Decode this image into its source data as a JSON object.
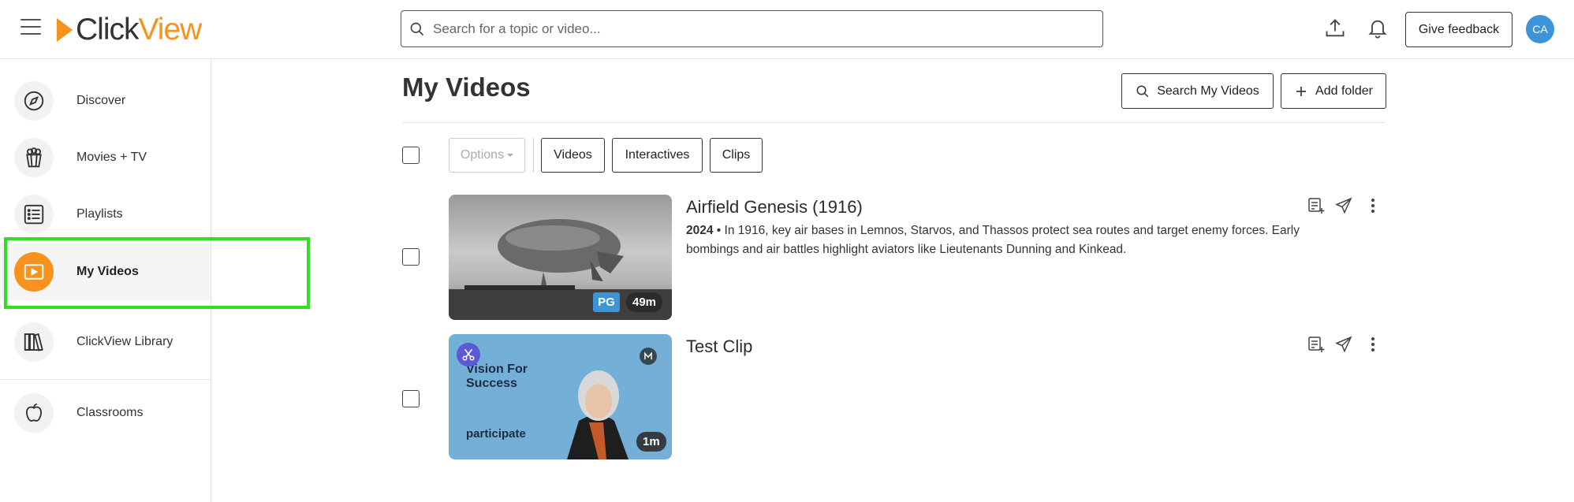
{
  "header": {
    "logo_part1": "Click",
    "logo_part2": "View",
    "search_placeholder": "Search for a topic or video...",
    "feedback_label": "Give feedback",
    "avatar_initials": "CA"
  },
  "sidebar": {
    "items": [
      {
        "label": "Discover",
        "icon": "compass-icon"
      },
      {
        "label": "Movies + TV",
        "icon": "popcorn-icon"
      },
      {
        "label": "Playlists",
        "icon": "list-icon"
      },
      {
        "label": "My Videos",
        "icon": "play-screen-icon",
        "active": true
      },
      {
        "label": "ClickView Library",
        "icon": "library-icon"
      },
      {
        "label": "Classrooms",
        "icon": "apple-icon"
      }
    ]
  },
  "main": {
    "title": "My Videos",
    "search_my_videos_label": "Search My Videos",
    "add_folder_label": "Add folder",
    "options_label": "Options",
    "filters": [
      "Videos",
      "Interactives",
      "Clips"
    ],
    "videos": [
      {
        "title": "Airfield Genesis (1916)",
        "year": "2024",
        "separator": " • ",
        "description": "In 1916, key air bases in Lemnos, Starvos, and Thassos protect sea routes and target enemy forces. Early bombings and air battles highlight aviators like Lieutenants Dunning and Kinkead.",
        "rating": "PG",
        "duration": "49m"
      },
      {
        "title": "Test Clip",
        "duration": "1m",
        "thumb_text_1": "Vision For",
        "thumb_text_2": "Success",
        "thumb_text_3": "participate"
      }
    ]
  },
  "colors": {
    "brand_orange": "#f7921e",
    "accent_blue": "#3d94d8",
    "highlight_green": "#33dd22"
  }
}
